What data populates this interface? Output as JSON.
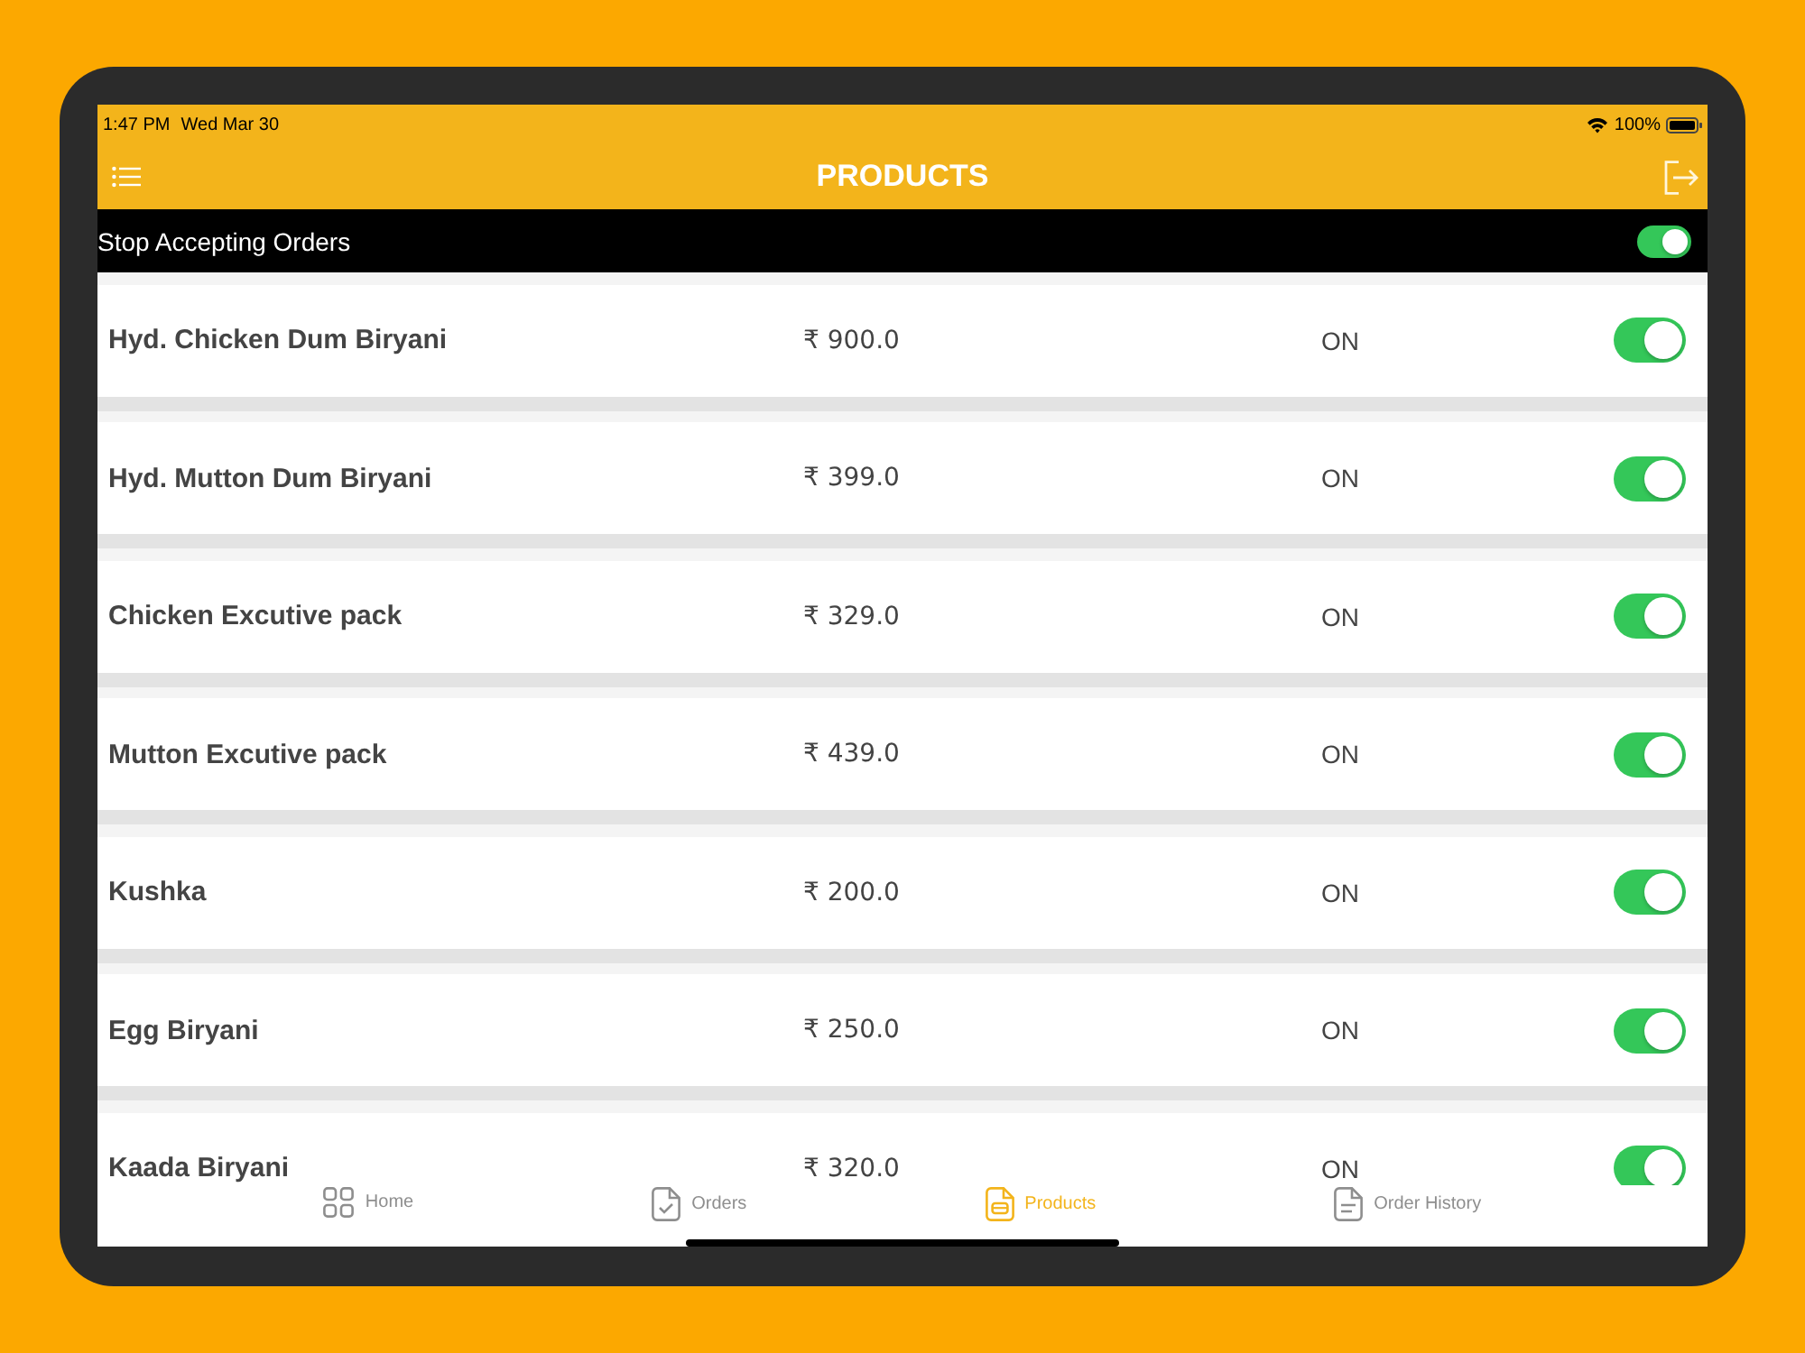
{
  "status_bar": {
    "time": "1:47 PM",
    "date": "Wed Mar 30",
    "battery": "100%"
  },
  "header": {
    "title": "PRODUCTS"
  },
  "stop_orders": {
    "label": "Stop Accepting Orders",
    "on": true
  },
  "products": [
    {
      "name": "Hyd. Chicken Dum Biryani",
      "price": "₹ 900.0",
      "status": "ON",
      "on": true
    },
    {
      "name": "Hyd. Mutton Dum Biryani",
      "price": "₹ 399.0",
      "status": "ON",
      "on": true
    },
    {
      "name": "Chicken Excutive pack",
      "price": "₹ 329.0",
      "status": "ON",
      "on": true
    },
    {
      "name": "Mutton Excutive pack",
      "price": "₹ 439.0",
      "status": "ON",
      "on": true
    },
    {
      "name": "Kushka",
      "price": "₹ 200.0",
      "status": "ON",
      "on": true
    },
    {
      "name": "Egg Biryani",
      "price": "₹ 250.0",
      "status": "ON",
      "on": true
    },
    {
      "name": "Kaada Biryani",
      "price": "₹ 320.0",
      "status": "ON",
      "on": true
    }
  ],
  "tabs": [
    {
      "label": "Home",
      "selected": false
    },
    {
      "label": "Orders",
      "selected": false
    },
    {
      "label": "Products",
      "selected": true
    },
    {
      "label": "Order History",
      "selected": false
    }
  ]
}
